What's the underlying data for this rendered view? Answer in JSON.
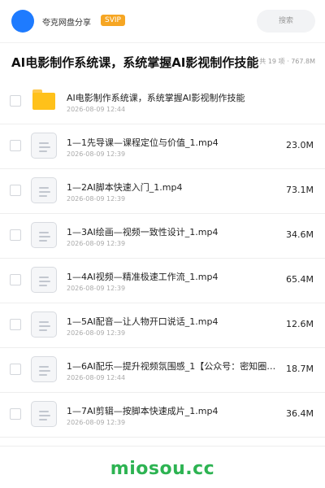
{
  "header": {
    "user_name": "夸克网盘分享",
    "badge": "SVIP",
    "search_placeholder": "搜索"
  },
  "folder": {
    "title": "AI电影制作系统课，系统掌握AI影视制作技能",
    "meta": "共 19 项 · 767.8M"
  },
  "items": [
    {
      "type": "folder",
      "name": "AI电影制作系统课，系统掌握AI影视制作技能",
      "date": "2026-08-09 12:44",
      "size": ""
    },
    {
      "type": "file",
      "name": "1—1先导课—课程定位与价值_1.mp4",
      "date": "2026-08-09 12:39",
      "size": "23.0M"
    },
    {
      "type": "file",
      "name": "1—2AI脚本快速入门_1.mp4",
      "date": "2026-08-09 12:39",
      "size": "73.1M"
    },
    {
      "type": "file",
      "name": "1—3AI绘画—视频一致性设计_1.mp4",
      "date": "2026-08-09 12:39",
      "size": "34.6M"
    },
    {
      "type": "file",
      "name": "1—4AI视频—精准极速工作流_1.mp4",
      "date": "2026-08-09 12:39",
      "size": "65.4M"
    },
    {
      "type": "file",
      "name": "1—5AI配音—让人物开口说话_1.mp4",
      "date": "2026-08-09 12:39",
      "size": "12.6M"
    },
    {
      "type": "file",
      "name": "1—6AI配乐—提升视频氛围感_1【公众号：密知圈…",
      "date": "2026-08-09 12:44",
      "size": "18.7M"
    },
    {
      "type": "file",
      "name": "1—7AI剪辑—按脚本快速成片_1.mp4",
      "date": "2026-08-09 12:39",
      "size": "36.4M"
    }
  ],
  "watermark": "miosou.cc"
}
